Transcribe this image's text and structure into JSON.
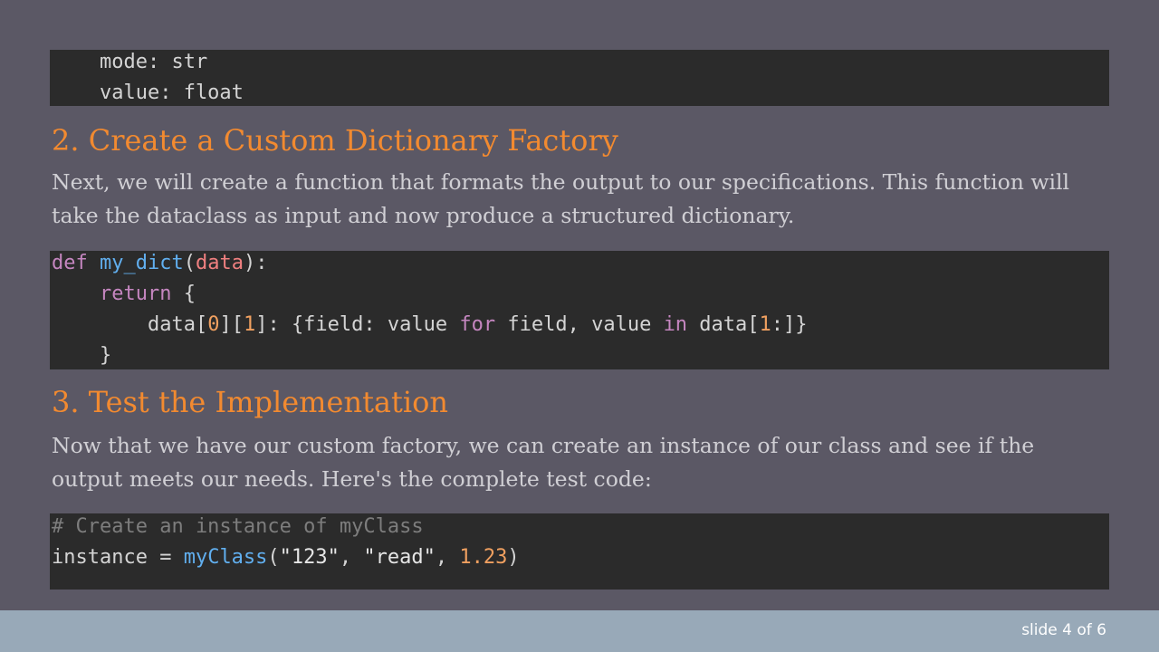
{
  "code_block_1": {
    "lines": [
      "    mode: str",
      "    value: float"
    ]
  },
  "section_2": {
    "heading": "2. Create a Custom Dictionary Factory",
    "paragraph": "Next, we will create a function that formats the output to our specifications. This function will take the dataclass as input and now produce a structured dictionary."
  },
  "code_block_2": {
    "line1": {
      "kw": "def",
      "fn": "my_dict",
      "open": "(",
      "param": "data",
      "close": "):"
    },
    "line2": {
      "indent": "    ",
      "kw": "return",
      "rest": " {"
    },
    "line3": {
      "indent": "        ",
      "a": "data[",
      "n0": "0",
      "b": "][",
      "n1": "1",
      "c": "]: {field: value ",
      "kw_for": "for",
      "d": " field, value ",
      "kw_in": "in",
      "e": " data[",
      "n2": "1",
      "f": ":]}"
    },
    "line4": {
      "text": "    }"
    }
  },
  "section_3": {
    "heading": "3. Test the Implementation",
    "paragraph": "Now that we have our custom factory, we can create an instance of our class and see if the output meets our needs. Here's the complete test code:"
  },
  "code_block_3": {
    "comment": "# Create an instance of myClass",
    "line2": {
      "a": "instance = ",
      "fn": "myClass",
      "b": "(",
      "s1": "\"123\"",
      "c": ", ",
      "s2": "\"read\"",
      "d": ", ",
      "num": "1.23",
      "e": ")"
    }
  },
  "footer": {
    "slide_number": "slide 4 of 6"
  },
  "colors": {
    "background": "#5b5865",
    "heading": "#f28a30",
    "code_background": "#2b2b2b",
    "footer": "#98a9b8"
  }
}
